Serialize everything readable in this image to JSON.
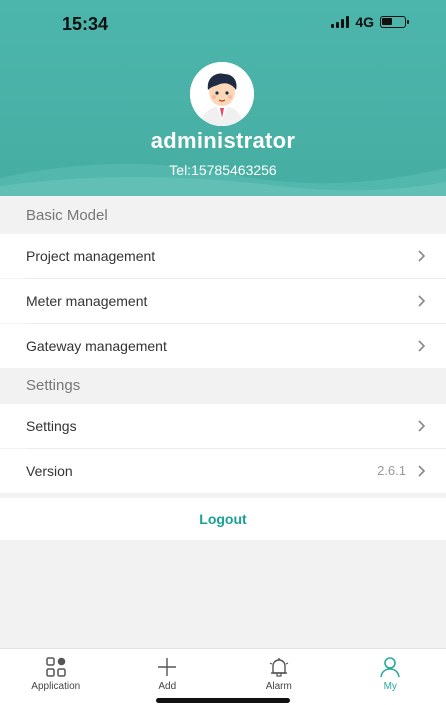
{
  "status_bar": {
    "time": "15:34",
    "network": "4G"
  },
  "profile": {
    "username": "administrator",
    "phone": "Tel:15785463256"
  },
  "sections": {
    "basic_model": {
      "title": "Basic Model",
      "items": [
        {
          "label": "Project management"
        },
        {
          "label": "Meter management"
        },
        {
          "label": "Gateway management"
        }
      ]
    },
    "settings": {
      "title": "Settings",
      "items": [
        {
          "label": "Settings"
        },
        {
          "label": "Version",
          "value": "2.6.1"
        }
      ]
    }
  },
  "logout_label": "Logout",
  "tabbar": {
    "items": [
      {
        "label": "Application",
        "icon": "grid-icon"
      },
      {
        "label": "Add",
        "icon": "plus-icon"
      },
      {
        "label": "Alarm",
        "icon": "bell-icon"
      },
      {
        "label": "My",
        "icon": "person-icon",
        "active": true
      }
    ]
  },
  "colors": {
    "header": "#4db6ac",
    "accent": "#29a99d",
    "background": "#f2f2f2"
  }
}
